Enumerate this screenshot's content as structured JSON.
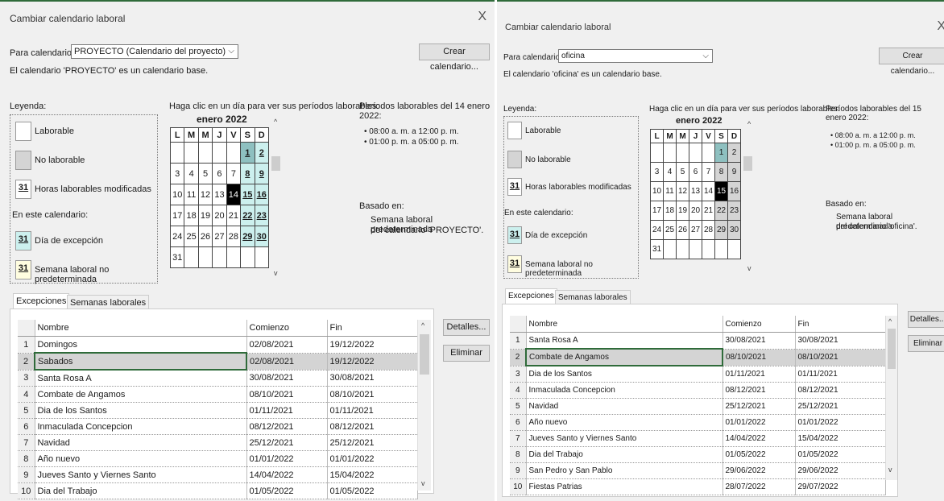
{
  "left": {
    "title": "Cambiar calendario laboral",
    "close": "X",
    "for_calendar_label": "Para calendario:",
    "for_calendar_value": "PROYECTO (Calendario del proyecto)",
    "create_btn": "Crear calendario...",
    "base_msg": "El calendario 'PROYECTO' es un calendario base.",
    "legend_label": "Leyenda:",
    "legend_working": "Laborable",
    "legend_nonworking": "No laborable",
    "legend_31": "31",
    "legend_modified": "Horas laborables modificadas",
    "on_this_calendar": "En este calendario:",
    "legend_exception": "Día de excepción",
    "legend_nondefault": "Semana laboral no predeterminada",
    "click_msg": "Haga clic en un día para ver sus períodos laborables:",
    "month": "enero 2022",
    "days": [
      "L",
      "M",
      "M",
      "J",
      "V",
      "S",
      "D"
    ],
    "periods_title": "Períodos laborables del 14 enero 2022:",
    "period1": "• 08:00 a. m. a 12:00 p. m.",
    "period2": "• 01:00 p. m. a 05:00 p. m.",
    "based_on": "Basado en:",
    "based_text1": "Semana laboral predeterminada",
    "based_text2": "del calendario 'PROYECTO'.",
    "tab_exceptions": "Excepciones",
    "tab_work_weeks": "Semanas laborales",
    "col_name": "Nombre",
    "col_start": "Comienzo",
    "col_end": "Fin",
    "details_btn": "Detalles...",
    "delete_btn": "Eliminar",
    "rows": [
      {
        "n": "1",
        "name": "Domingos",
        "start": "02/08/2021",
        "end": "19/12/2022"
      },
      {
        "n": "2",
        "name": "Sabados",
        "start": "02/08/2021",
        "end": "19/12/2022"
      },
      {
        "n": "3",
        "name": "Santa Rosa A",
        "start": "30/08/2021",
        "end": "30/08/2021"
      },
      {
        "n": "4",
        "name": "Combate de Angamos",
        "start": "08/10/2021",
        "end": "08/10/2021"
      },
      {
        "n": "5",
        "name": "Dia de los Santos",
        "start": "01/11/2021",
        "end": "01/11/2021"
      },
      {
        "n": "6",
        "name": "Inmaculada Concepcion",
        "start": "08/12/2021",
        "end": "08/12/2021"
      },
      {
        "n": "7",
        "name": "Navidad",
        "start": "25/12/2021",
        "end": "25/12/2021"
      },
      {
        "n": "8",
        "name": "Año nuevo",
        "start": "01/01/2022",
        "end": "01/01/2022"
      },
      {
        "n": "9",
        "name": "Jueves Santo y Viernes Santo",
        "start": "14/04/2022",
        "end": "15/04/2022"
      },
      {
        "n": "10",
        "name": "Dia del Trabajo",
        "start": "01/05/2022",
        "end": "01/05/2022"
      }
    ]
  },
  "right": {
    "title": "Cambiar calendario laboral",
    "close": "X",
    "for_calendar_label": "Para calendario:",
    "for_calendar_value": "oficina",
    "create_btn": "Crear calendario...",
    "base_msg": "El calendario 'oficina' es un calendario base.",
    "legend_label": "Leyenda:",
    "legend_working": "Laborable",
    "legend_nonworking": "No laborable",
    "legend_31": "31",
    "legend_modified": "Horas laborables modificadas",
    "on_this_calendar": "En este calendario:",
    "legend_exception": "Día de excepción",
    "legend_nondefault": "Semana laboral no predeterminada",
    "click_msg": "Haga clic en un día para ver sus períodos laborables:",
    "month": "enero 2022",
    "days": [
      "L",
      "M",
      "M",
      "J",
      "V",
      "S",
      "D"
    ],
    "periods_title": "Períodos laborables del 15 enero 2022:",
    "period1": "• 08:00 a. m. a 12:00 p. m.",
    "period2": "• 01:00 p. m. a 05:00 p. m.",
    "based_on": "Basado en:",
    "based_text1": "Semana laboral predeterminada",
    "based_text2": "del calendario 'oficina'.",
    "tab_exceptions": "Excepciones",
    "tab_work_weeks": "Semanas laborales",
    "col_name": "Nombre",
    "col_start": "Comienzo",
    "col_end": "Fin",
    "details_btn": "Detalles...",
    "delete_btn": "Eliminar",
    "rows": [
      {
        "n": "1",
        "name": "Santa Rosa A",
        "start": "30/08/2021",
        "end": "30/08/2021"
      },
      {
        "n": "2",
        "name": "Combate de Angamos",
        "start": "08/10/2021",
        "end": "08/10/2021"
      },
      {
        "n": "3",
        "name": "Dia de los Santos",
        "start": "01/11/2021",
        "end": "01/11/2021"
      },
      {
        "n": "4",
        "name": "Inmaculada Concepcion",
        "start": "08/12/2021",
        "end": "08/12/2021"
      },
      {
        "n": "5",
        "name": "Navidad",
        "start": "25/12/2021",
        "end": "25/12/2021"
      },
      {
        "n": "6",
        "name": "Año nuevo",
        "start": "01/01/2022",
        "end": "01/01/2022"
      },
      {
        "n": "7",
        "name": "Jueves Santo y Viernes Santo",
        "start": "14/04/2022",
        "end": "15/04/2022"
      },
      {
        "n": "8",
        "name": "Dia del Trabajo",
        "start": "01/05/2022",
        "end": "01/05/2022"
      },
      {
        "n": "9",
        "name": "San Pedro y San Pablo",
        "start": "29/06/2022",
        "end": "29/06/2022"
      },
      {
        "n": "10",
        "name": "Fiestas Patrias",
        "start": "28/07/2022",
        "end": "29/07/2022"
      }
    ]
  }
}
